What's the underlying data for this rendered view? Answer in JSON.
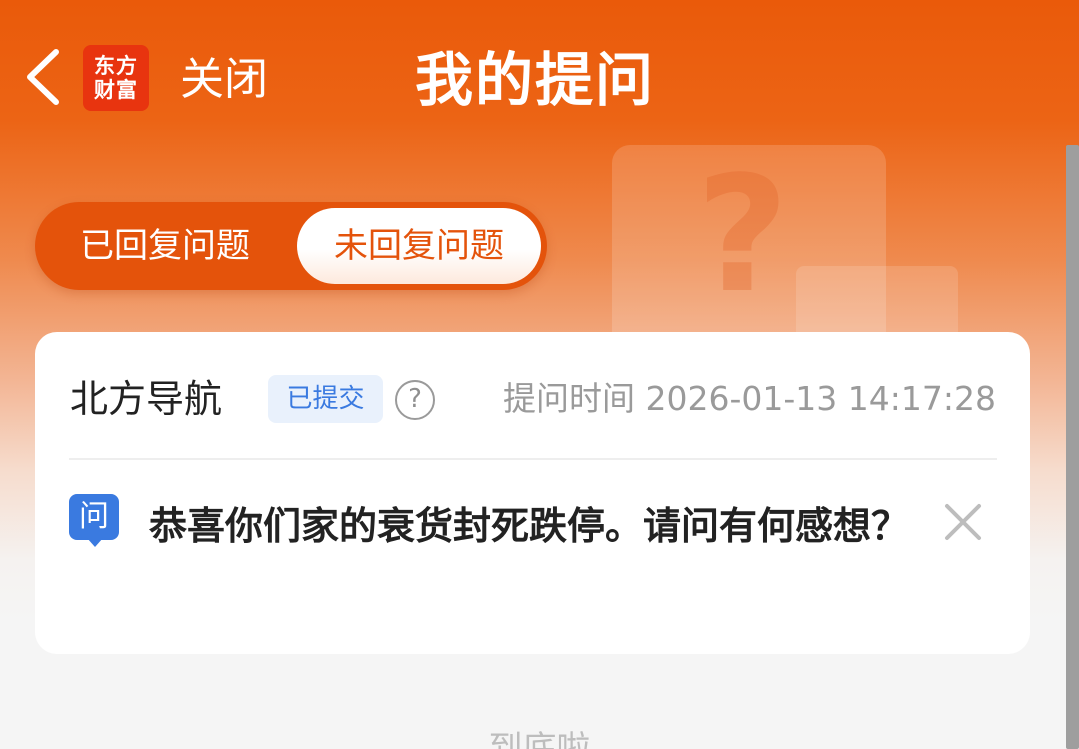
{
  "header": {
    "back_icon": "chevron-left-icon",
    "logo_line1": "东方",
    "logo_line2": "财富",
    "close_label": "关闭",
    "title": "我的提问"
  },
  "tabs": [
    {
      "label": "已回复问题",
      "active": false
    },
    {
      "label": "未回复问题",
      "active": true
    }
  ],
  "question_card": {
    "stock_name": "北方导航",
    "status": "已提交",
    "help_icon": "question-circle-icon",
    "help_glyph": "?",
    "time_label": "提问时间",
    "time_value": "2026-01-13 14:17:28",
    "question_icon_label": "问",
    "question_text": "恭喜你们家的衰货封死跌停。请问有何感想？",
    "delete_icon": "close-icon"
  },
  "footer": {
    "end_text": "到底啦"
  },
  "colors": {
    "brand_orange": "#ea5a0a",
    "tab_bg": "#e4530b",
    "accent_blue": "#3a7ae0",
    "logo_red": "#e8340f"
  }
}
